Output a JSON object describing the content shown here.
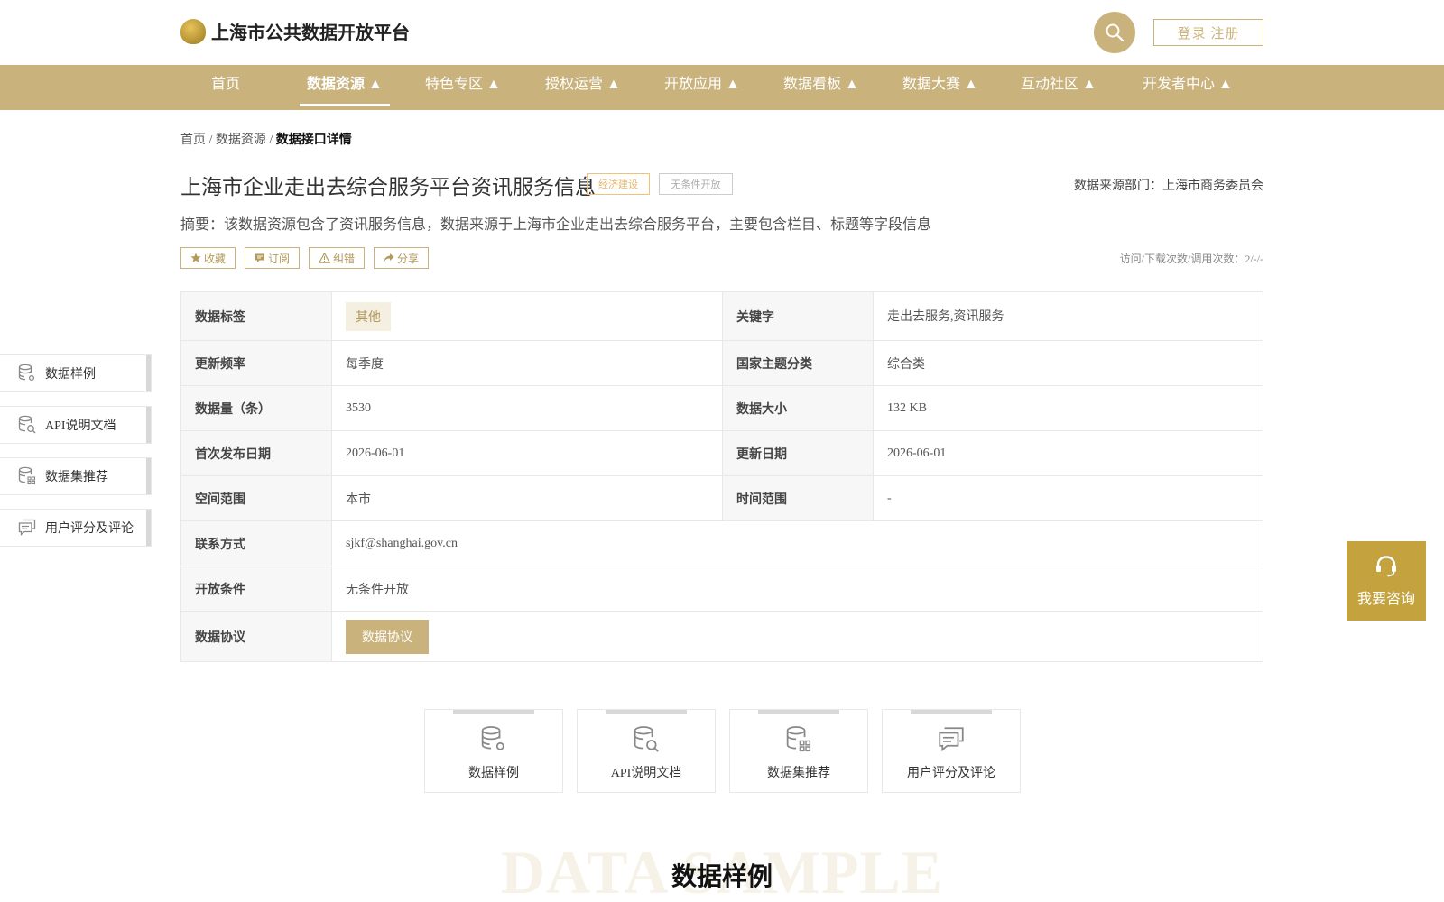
{
  "header": {
    "logo_text": "上海市公共数据开放平台",
    "login_label": "登录 注册"
  },
  "nav": {
    "items": [
      {
        "label": "首页"
      },
      {
        "label": "数据资源 ▲"
      },
      {
        "label": "特色专区 ▲"
      },
      {
        "label": "授权运营 ▲"
      },
      {
        "label": "开放应用 ▲"
      },
      {
        "label": "数据看板 ▲"
      },
      {
        "label": "数据大赛 ▲"
      },
      {
        "label": "互动社区 ▲"
      },
      {
        "label": "开发者中心 ▲"
      }
    ],
    "active_index": 1
  },
  "breadcrumb": {
    "home": "首页",
    "sep": " / ",
    "section": "数据资源",
    "current": "数据接口详情"
  },
  "detail": {
    "title": "上海市企业走出去综合服务平台资讯服务信息",
    "tag_theme": "经济建设",
    "tag_open": "无条件开放",
    "source": "数据来源部门：上海市商务委员会",
    "summary": "摘要：该数据资源包含了资讯服务信息，数据来源于上海市企业走出去综合服务平台，主要包含栏目、标题等字段信息",
    "actions": {
      "favorite": "收藏",
      "subscribe": "订阅",
      "report": "纠错",
      "share": "分享"
    },
    "visits": "访问/下载次数/调用次数：2/-/-"
  },
  "table": {
    "data_tag_label": "数据标签",
    "data_tag_value": "其他",
    "keyword_label": "关键字",
    "keyword_value": "走出去服务,资讯服务",
    "frequency_label": "更新频率",
    "frequency_value": "每季度",
    "national_topic_label": "国家主题分类",
    "national_topic_value": "综合类",
    "count_label": "数据量（条）",
    "count_value": "3530",
    "size_label": "数据大小",
    "size_value": "132 KB",
    "first_publish_label": "首次发布日期",
    "first_publish_value": "2026-06-01",
    "update_label": "更新日期",
    "update_value": "2026-06-01",
    "space_label": "空间范围",
    "space_value": "本市",
    "time_label": "时间范围",
    "time_value": "-",
    "contact_label": "联系方式",
    "contact_value": "sjkf@shanghai.gov.cn",
    "condition_label": "开放条件",
    "condition_value": "无条件开放",
    "agreement_label": "数据协议",
    "agreement_button": "数据协议"
  },
  "side_menu": [
    {
      "label": "数据样例",
      "icon": "database-gear-icon"
    },
    {
      "label": "API说明文档",
      "icon": "database-search-icon"
    },
    {
      "label": "数据集推荐",
      "icon": "database-grid-icon"
    },
    {
      "label": "用户评分及评论",
      "icon": "comment-icon"
    }
  ],
  "consult": {
    "label": "我要咨询"
  },
  "tabs": [
    {
      "label": "数据样例"
    },
    {
      "label": "API说明文档"
    },
    {
      "label": "数据集推荐"
    },
    {
      "label": "用户评分及评论"
    }
  ],
  "section": {
    "bg_text": "DATA SAMPLE",
    "title": "数据样例"
  },
  "colors": {
    "brand": "#c9b27c",
    "consult": "#c4a33e"
  }
}
